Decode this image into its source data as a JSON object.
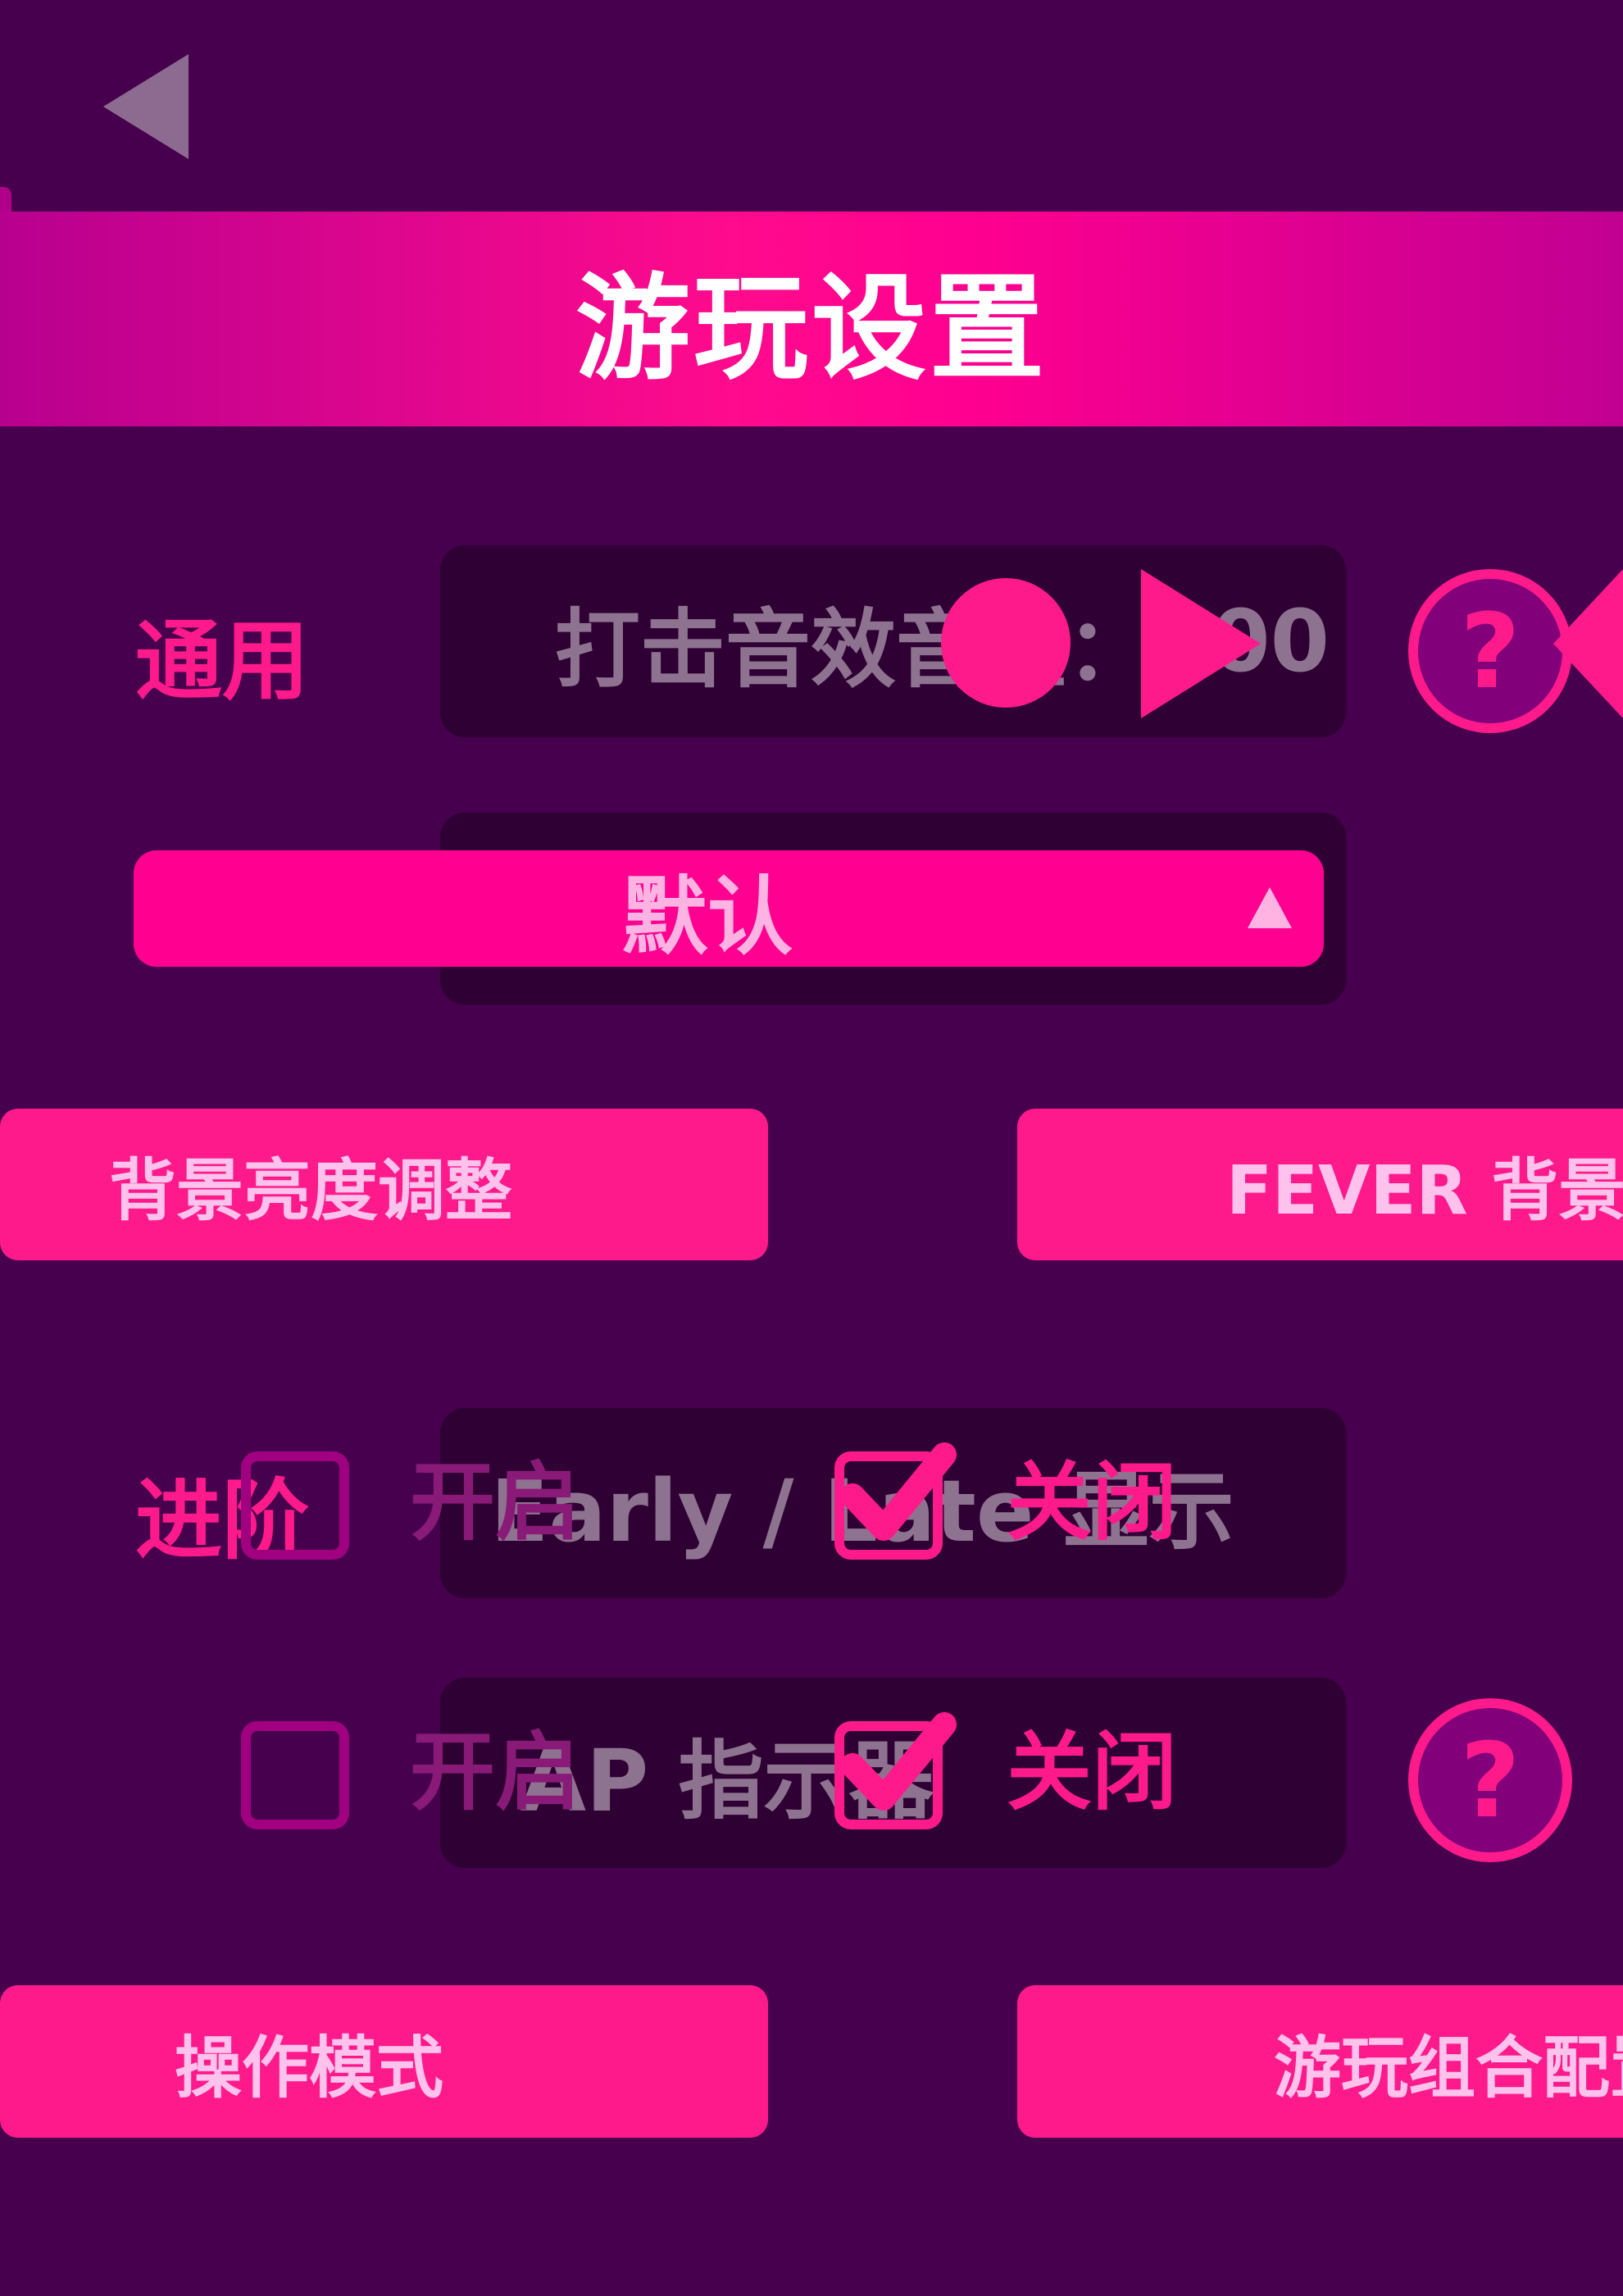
{
  "header": {
    "title": "游玩设置"
  },
  "sections": {
    "general": "通用",
    "advanced": "进阶"
  },
  "volume": {
    "label": "打击音效音量：",
    "value": "100"
  },
  "dropdown": {
    "selected": "默认"
  },
  "buttons": {
    "brightness": "背景亮度调整",
    "fever": "FEVER 背景调整",
    "control_mode": "操作模式",
    "combo_config": "游玩组合配置"
  },
  "early_late": {
    "label": "Early / Late 显示",
    "on_label": "开启",
    "off_label": "关闭",
    "checked": "off"
  },
  "ap_indicator": {
    "label": "AP 指示器",
    "on_label": "开启",
    "off_label": "关闭",
    "checked": "off"
  },
  "icons": {
    "back": "back-arrow-icon",
    "help": "question-mark-icon",
    "check": "checkmark-icon"
  },
  "colors": {
    "background": "#47004d",
    "accent": "#ff1a8c",
    "header": "#ff0090",
    "muted_text": "#8e7390"
  }
}
